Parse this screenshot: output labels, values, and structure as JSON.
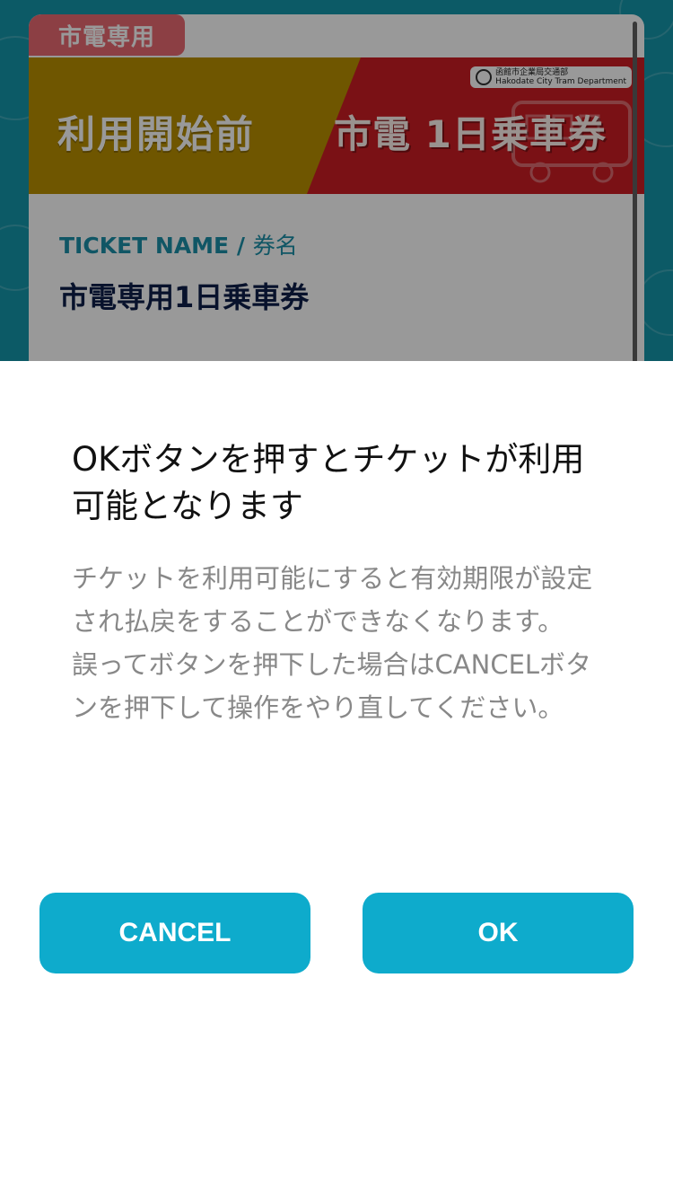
{
  "background": {
    "color": "#1596aa"
  },
  "ticket": {
    "badge": "市電専用",
    "banner_status": "利用開始前",
    "banner_name": "市電 1日乗車券",
    "department_ja": "函館市企業局交通部",
    "department_en": "Hakodate City Tram Department",
    "field_label_en": "TICKET NAME /",
    "field_label_ja": "券名",
    "ticket_name": "市電専用1日乗車券"
  },
  "dialog": {
    "title": "OKボタンを押すとチケットが利用可能となります",
    "message_line1": "チケットを利用可能にすると有効期限が設定され払戻をすることができなくなります。",
    "message_line2": "誤ってボタンを押下した場合はCANCELボタンを押下して操作をやり直してください。",
    "cancel_label": "CANCEL",
    "ok_label": "OK"
  },
  "colors": {
    "accent": "#0eabcc",
    "badge": "#e96a72",
    "banner_red": "#cc1d23",
    "banner_gold": "#b98f00",
    "label_teal": "#1b8fa8"
  }
}
